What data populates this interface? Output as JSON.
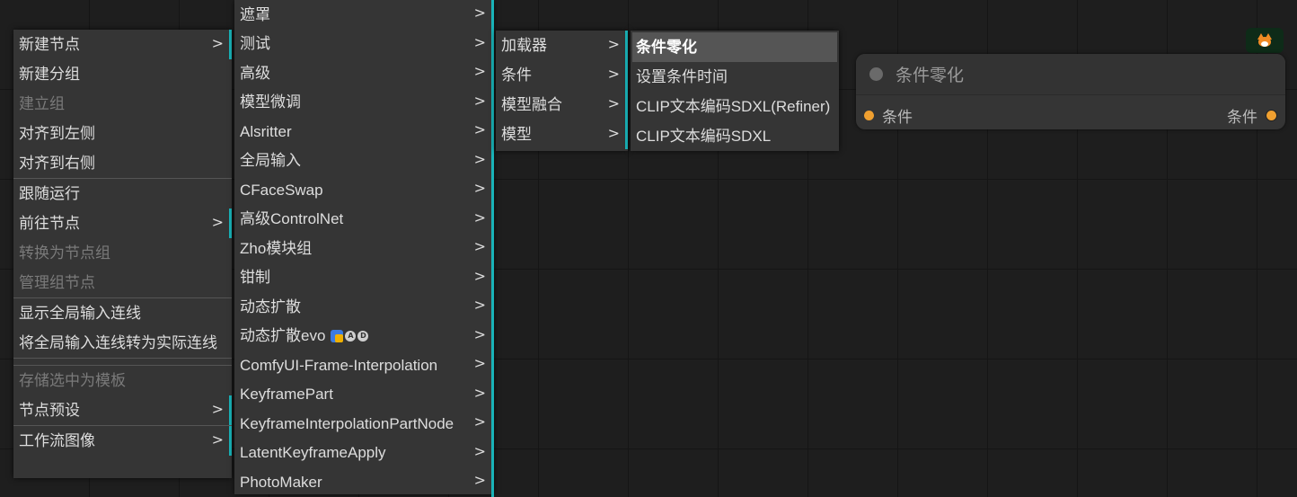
{
  "context_menu": {
    "items": [
      {
        "label": "新建节点",
        "has_sub": true,
        "disabled": false
      },
      {
        "label": "新建分组",
        "has_sub": false,
        "disabled": false
      },
      {
        "label": "建立组",
        "has_sub": false,
        "disabled": true
      },
      {
        "label": "对齐到左侧",
        "has_sub": false,
        "disabled": false
      },
      {
        "label": "对齐到右侧",
        "has_sub": false,
        "disabled": false
      },
      {
        "label": "跟随运行",
        "has_sub": false,
        "disabled": false
      },
      {
        "label": "前往节点",
        "has_sub": true,
        "disabled": false
      },
      {
        "label": "转换为节点组",
        "has_sub": false,
        "disabled": true
      },
      {
        "label": "管理组节点",
        "has_sub": false,
        "disabled": true
      },
      {
        "label": "显示全局输入连线",
        "has_sub": false,
        "disabled": false
      },
      {
        "label": "将全局输入连线转为实际连线",
        "has_sub": false,
        "disabled": false
      },
      {
        "label": "存储选中为模板",
        "has_sub": false,
        "disabled": true
      },
      {
        "label": "节点预设",
        "has_sub": true,
        "disabled": false
      },
      {
        "label": "工作流图像",
        "has_sub": true,
        "disabled": false
      }
    ],
    "arrow": ">"
  },
  "node_categories": {
    "items": [
      "遮罩",
      "测试",
      "高级",
      "模型微调",
      "Alsritter",
      "全局输入",
      "CFaceSwap",
      "高级ControlNet",
      "Zho模块组",
      "钳制",
      "动态扩散",
      "动态扩散evo",
      "ComfyUI-Frame-Interpolation",
      "KeyframePart",
      "KeyframeInterpolationPartNode",
      "LatentKeyframeApply",
      "PhotoMaker"
    ],
    "evo_badges": [
      "A",
      "D"
    ]
  },
  "advanced_submenu": {
    "items": [
      "加载器",
      "条件",
      "模型融合",
      "模型"
    ]
  },
  "conditioning_submenu": {
    "items": [
      "条件零化",
      "设置条件时间",
      "CLIP文本编码SDXL(Refiner)",
      "CLIP文本编码SDXL"
    ],
    "highlighted_index": 0
  },
  "node": {
    "title": "条件零化",
    "input_label": "条件",
    "output_label": "条件"
  },
  "colors": {
    "canvas": "#1e1e1e",
    "menu_bg": "#353535",
    "submenu_accent": "#19b3b8",
    "slot_conditioning": "#f0a030"
  },
  "icons": {
    "badge": "fox-icon"
  }
}
